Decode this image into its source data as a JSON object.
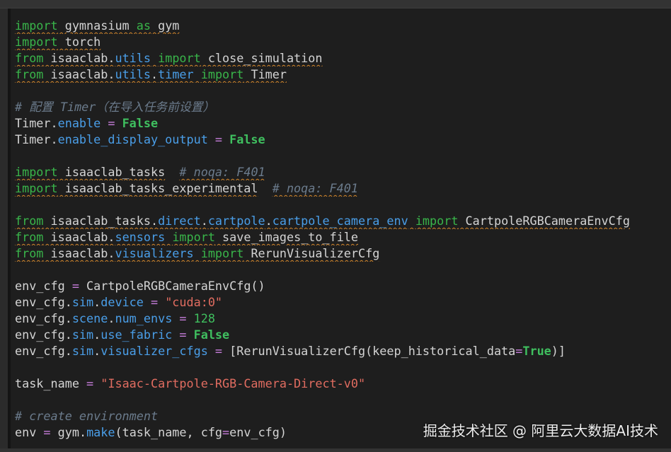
{
  "colors": {
    "background": "#1e1e1e",
    "keyword": "#39b54a",
    "attribute": "#4a9ee8",
    "operator": "#c77ddb",
    "boolean": "#3fbf5f",
    "string": "#e06c60",
    "comment": "#6b7b8c",
    "plain": "#d4d4d4",
    "squiggle": "#d7892c"
  },
  "code": {
    "lines": [
      [
        {
          "t": "import",
          "c": "kw",
          "sq": true
        },
        {
          "t": " gymnasium ",
          "c": "mod",
          "sq": true
        },
        {
          "t": "as",
          "c": "kw",
          "sq": true
        },
        {
          "t": " gym",
          "c": "mod",
          "sq": true
        }
      ],
      [
        {
          "t": "import",
          "c": "kw",
          "sq": true
        },
        {
          "t": " torch",
          "c": "mod",
          "sq": true
        }
      ],
      [
        {
          "t": "from",
          "c": "kw",
          "sq": true
        },
        {
          "t": " isaaclab.",
          "c": "mod",
          "sq": true
        },
        {
          "t": "utils",
          "c": "attr",
          "sq": true
        },
        {
          "t": " ",
          "c": "mod",
          "sq": true
        },
        {
          "t": "import",
          "c": "kw",
          "sq": true
        },
        {
          "t": " close_simulation",
          "c": "mod",
          "sq": true
        }
      ],
      [
        {
          "t": "from",
          "c": "kw",
          "sq": true
        },
        {
          "t": " isaaclab.",
          "c": "mod",
          "sq": true
        },
        {
          "t": "utils",
          "c": "attr",
          "sq": true
        },
        {
          "t": ".",
          "c": "mod",
          "sq": true
        },
        {
          "t": "timer",
          "c": "attr",
          "sq": true
        },
        {
          "t": " ",
          "c": "mod",
          "sq": true
        },
        {
          "t": "import",
          "c": "kw",
          "sq": true
        },
        {
          "t": " Timer",
          "c": "mod",
          "sq": true
        }
      ],
      [],
      [
        {
          "t": "# 配置 Timer（在导入任务前设置）",
          "c": "com"
        }
      ],
      [
        {
          "t": "Timer.",
          "c": "mod"
        },
        {
          "t": "enable",
          "c": "attr"
        },
        {
          "t": " ",
          "c": "mod"
        },
        {
          "t": "=",
          "c": "op"
        },
        {
          "t": " ",
          "c": "mod"
        },
        {
          "t": "False",
          "c": "bool"
        }
      ],
      [
        {
          "t": "Timer.",
          "c": "mod"
        },
        {
          "t": "enable_display_output",
          "c": "attr"
        },
        {
          "t": " ",
          "c": "mod"
        },
        {
          "t": "=",
          "c": "op"
        },
        {
          "t": " ",
          "c": "mod"
        },
        {
          "t": "False",
          "c": "bool"
        }
      ],
      [],
      [
        {
          "t": "import",
          "c": "kw",
          "sq": true
        },
        {
          "t": " isaaclab_tasks",
          "c": "mod",
          "sq": true
        },
        {
          "t": "  ",
          "c": "mod"
        },
        {
          "t": "# noqa: F401",
          "c": "com",
          "sq": true
        }
      ],
      [
        {
          "t": "import",
          "c": "kw",
          "sq": true
        },
        {
          "t": " isaaclab_tasks_experimental",
          "c": "mod",
          "sq": true
        },
        {
          "t": "  ",
          "c": "mod"
        },
        {
          "t": "# noqa: F401",
          "c": "com",
          "sq": true
        }
      ],
      [],
      [
        {
          "t": "from",
          "c": "kw",
          "sq": true
        },
        {
          "t": " isaaclab_tasks.",
          "c": "mod",
          "sq": true
        },
        {
          "t": "direct",
          "c": "attr",
          "sq": true
        },
        {
          "t": ".",
          "c": "mod",
          "sq": true
        },
        {
          "t": "cartpole",
          "c": "attr",
          "sq": true
        },
        {
          "t": ".",
          "c": "mod",
          "sq": true
        },
        {
          "t": "cartpole_camera_env",
          "c": "attr",
          "sq": true
        },
        {
          "t": " ",
          "c": "mod",
          "sq": true
        },
        {
          "t": "import",
          "c": "kw",
          "sq": true
        },
        {
          "t": " CartpoleRGBCameraEnvCfg",
          "c": "mod",
          "sq": true
        }
      ],
      [
        {
          "t": "from",
          "c": "kw",
          "sq": true
        },
        {
          "t": " isaaclab.",
          "c": "mod",
          "sq": true
        },
        {
          "t": "sensors",
          "c": "attr",
          "sq": true
        },
        {
          "t": " ",
          "c": "mod",
          "sq": true
        },
        {
          "t": "import",
          "c": "kw",
          "sq": true
        },
        {
          "t": " save_images_to_file",
          "c": "mod",
          "sq": true
        }
      ],
      [
        {
          "t": "from",
          "c": "kw",
          "sq": true
        },
        {
          "t": " isaaclab.",
          "c": "mod",
          "sq": true
        },
        {
          "t": "visualizers",
          "c": "attr",
          "sq": true
        },
        {
          "t": " ",
          "c": "mod",
          "sq": true
        },
        {
          "t": "import",
          "c": "kw",
          "sq": true
        },
        {
          "t": " RerunVisualizerCfg",
          "c": "mod",
          "sq": true
        }
      ],
      [],
      [
        {
          "t": "env_cfg",
          "c": "mod"
        },
        {
          "t": " ",
          "c": "mod"
        },
        {
          "t": "=",
          "c": "op"
        },
        {
          "t": " CartpoleRGBCameraEnvCfg()",
          "c": "mod"
        }
      ],
      [
        {
          "t": "env_cfg.",
          "c": "mod"
        },
        {
          "t": "sim",
          "c": "attr"
        },
        {
          "t": ".",
          "c": "mod"
        },
        {
          "t": "device",
          "c": "attr"
        },
        {
          "t": " ",
          "c": "mod"
        },
        {
          "t": "=",
          "c": "op"
        },
        {
          "t": " ",
          "c": "mod"
        },
        {
          "t": "\"cuda:0\"",
          "c": "str"
        }
      ],
      [
        {
          "t": "env_cfg.",
          "c": "mod"
        },
        {
          "t": "scene",
          "c": "attr"
        },
        {
          "t": ".",
          "c": "mod"
        },
        {
          "t": "num_envs",
          "c": "attr"
        },
        {
          "t": " ",
          "c": "mod"
        },
        {
          "t": "=",
          "c": "op"
        },
        {
          "t": " ",
          "c": "mod"
        },
        {
          "t": "128",
          "c": "num"
        }
      ],
      [
        {
          "t": "env_cfg.",
          "c": "mod"
        },
        {
          "t": "sim",
          "c": "attr"
        },
        {
          "t": ".",
          "c": "mod"
        },
        {
          "t": "use_fabric",
          "c": "attr"
        },
        {
          "t": " ",
          "c": "mod"
        },
        {
          "t": "=",
          "c": "op"
        },
        {
          "t": " ",
          "c": "mod"
        },
        {
          "t": "False",
          "c": "bool"
        }
      ],
      [
        {
          "t": "env_cfg.",
          "c": "mod"
        },
        {
          "t": "sim",
          "c": "attr"
        },
        {
          "t": ".",
          "c": "mod"
        },
        {
          "t": "visualizer_cfgs",
          "c": "attr"
        },
        {
          "t": " ",
          "c": "mod"
        },
        {
          "t": "=",
          "c": "op"
        },
        {
          "t": " [RerunVisualizerCfg(keep_historical_data",
          "c": "mod"
        },
        {
          "t": "=",
          "c": "op"
        },
        {
          "t": "True",
          "c": "bool"
        },
        {
          "t": ")]",
          "c": "mod"
        }
      ],
      [],
      [
        {
          "t": "task_name",
          "c": "mod"
        },
        {
          "t": " ",
          "c": "mod"
        },
        {
          "t": "=",
          "c": "op"
        },
        {
          "t": " ",
          "c": "mod"
        },
        {
          "t": "\"Isaac-Cartpole-RGB-Camera-Direct-v0\"",
          "c": "str"
        }
      ],
      [],
      [
        {
          "t": "# create environment",
          "c": "com"
        }
      ],
      [
        {
          "t": "env",
          "c": "mod"
        },
        {
          "t": " ",
          "c": "mod"
        },
        {
          "t": "=",
          "c": "op"
        },
        {
          "t": " gym.",
          "c": "mod"
        },
        {
          "t": "make",
          "c": "attr"
        },
        {
          "t": "(task_name, cfg",
          "c": "mod"
        },
        {
          "t": "=",
          "c": "op"
        },
        {
          "t": "env_cfg)",
          "c": "mod"
        }
      ]
    ]
  },
  "watermark": {
    "text": "掘金技术社区 @ 阿里云大数据AI技术"
  }
}
